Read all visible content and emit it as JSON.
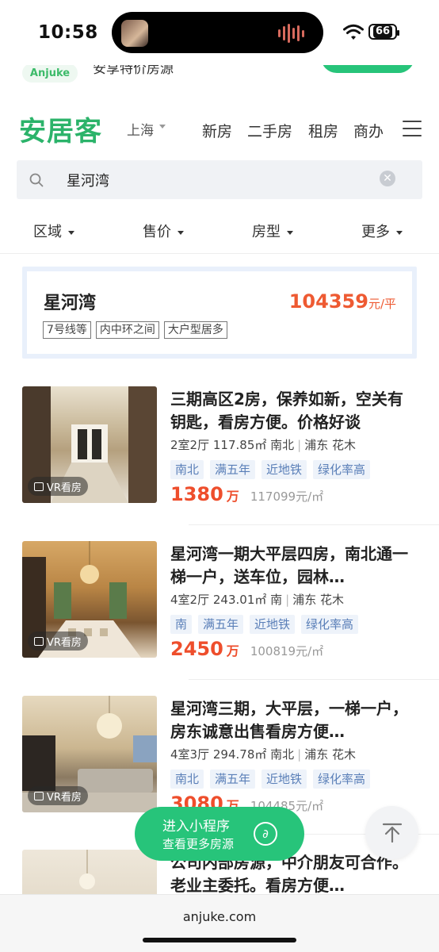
{
  "status_bar": {
    "time": "10:58",
    "battery": "66"
  },
  "promo": {
    "badge": "Anjuke",
    "text": "安享特价房源"
  },
  "header": {
    "logo": "安居客",
    "city": "上海",
    "nav": [
      "新房",
      "二手房",
      "租房",
      "商办"
    ]
  },
  "search": {
    "value": "星河湾"
  },
  "filters": [
    "区域",
    "售价",
    "房型",
    "更多"
  ],
  "summary": {
    "name": "星河湾",
    "price": "104359",
    "price_unit": "元/平",
    "tags": [
      "7号线等",
      "内中环之间",
      "大户型居多"
    ]
  },
  "listings": [
    {
      "title": "三期高区2房，保养如新，空关有钥匙，看房方便。价格好谈",
      "layout": "2室2厅",
      "area": "117.85㎡",
      "orientation": "南北",
      "district": "浦东",
      "block": "花木",
      "tags": [
        "南北",
        "满五年",
        "近地铁",
        "绿化率高"
      ],
      "price": "1380",
      "price_unit": "万",
      "unit_price": "117099元/㎡",
      "vr": "VR看房"
    },
    {
      "title": "星河湾一期大平层四房，南北通一梯一户，送车位，园林…",
      "layout": "4室2厅",
      "area": "243.01㎡",
      "orientation": "南",
      "district": "浦东",
      "block": "花木",
      "tags": [
        "南",
        "满五年",
        "近地铁",
        "绿化率高"
      ],
      "price": "2450",
      "price_unit": "万",
      "unit_price": "100819元/㎡",
      "vr": "VR看房"
    },
    {
      "title": "星河湾三期，大平层，一梯一户，房东诚意出售看房方便…",
      "layout": "4室3厅",
      "area": "294.78㎡",
      "orientation": "南北",
      "district": "浦东",
      "block": "花木",
      "tags": [
        "南北",
        "满五年",
        "近地铁",
        "绿化率高"
      ],
      "price": "3080",
      "price_unit": "万",
      "unit_price": "104485元/㎡",
      "vr": "VR看房"
    },
    {
      "title": "公司内部房源，中介朋友可合作。老业主委托。看房方便…"
    }
  ],
  "mini_program": {
    "line1": "进入小程序",
    "line2": "查看更多房源"
  },
  "browser": {
    "url": "anjuke.com"
  }
}
